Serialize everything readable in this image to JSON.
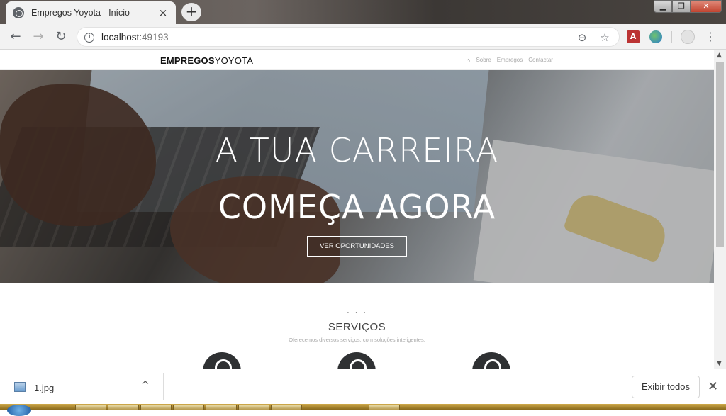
{
  "browser": {
    "tab_title": "Empregos Yoyota - Início",
    "tab_close": "×",
    "new_tab": "+",
    "window_controls": {
      "minimize": "▁",
      "maximize": "❐",
      "close": "✕"
    },
    "nav": {
      "back": "←",
      "forward": "→",
      "reload": "↻"
    },
    "url_host": "localhost:",
    "url_port": "49193",
    "zoom_icon": "⊖",
    "star_icon": "☆",
    "pdf_ext": "A",
    "menu": "⋮"
  },
  "site": {
    "brand_bold": "EMPREGOS",
    "brand_light": "YOYOTA",
    "nav_home_icon": "⌂",
    "nav_links": [
      "Sobre",
      "Empregos",
      "Contactar"
    ],
    "hero_line1": "A TUA CARREIRA",
    "hero_line2": "COMEÇA AGORA",
    "hero_button": "VER OPORTUNIDADES",
    "services_dots": ". . .",
    "services_title": "SERVIÇOS",
    "services_subtitle": "Oferecemos diversos serviços, com soluções inteligentes."
  },
  "downloads": {
    "file_name": "1.jpg",
    "caret": "^",
    "show_all": "Exibir todos",
    "close": "✕"
  },
  "scrollbar": {
    "up": "▲",
    "down": "▼"
  }
}
